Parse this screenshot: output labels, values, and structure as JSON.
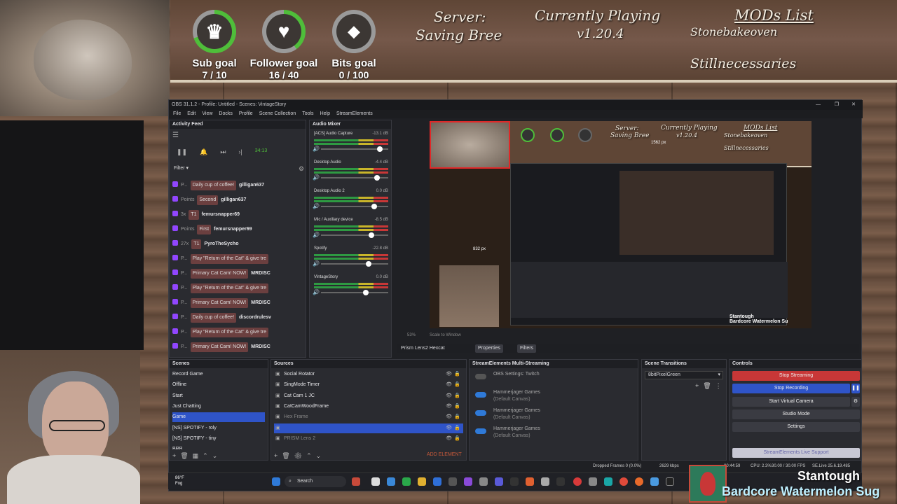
{
  "goals": [
    {
      "label": "Sub goal",
      "value": "7 / 10",
      "icon": "crown-icon",
      "progress": 0.7,
      "color": "#4fbe3a"
    },
    {
      "label": "Follower goal",
      "value": "16 / 40",
      "icon": "heart-icon",
      "progress": 0.4,
      "color": "#4fbe3a"
    },
    {
      "label": "Bits goal",
      "value": "0 / 100",
      "icon": "bits-icon",
      "progress": 0.0,
      "color": "#4fbe3a"
    }
  ],
  "banner": {
    "server_line1": "Server:",
    "server_line2": "Saving Bree",
    "playing_line1": "Currently Playing",
    "playing_line2": "v1.20.4",
    "mods_title": "MODs List",
    "mods_scroll1": "Stonebakeoven",
    "mods_scroll2": "Stillnecessaries"
  },
  "obs": {
    "title": "OBS 31.1.2 - Profile: Untitled - Scenes: VintageStory",
    "menu": [
      "File",
      "Edit",
      "View",
      "Docks",
      "Profile",
      "Scene Collection",
      "Tools",
      "Help",
      "StreamElements"
    ],
    "activity_feed": {
      "title": "Activity Feed",
      "filter_label": "Filter",
      "timer": "34:13",
      "rows": [
        {
          "tag": "P...",
          "pill": "Daily cup of coffee!",
          "user": "gilligan637"
        },
        {
          "tag": "Points",
          "pill": "Second",
          "user": "gilligan637"
        },
        {
          "tag": "3x",
          "pill": "T1",
          "user": "femursnapper69"
        },
        {
          "tag": "Points",
          "pill": "First",
          "user": "femursnapper69"
        },
        {
          "tag": "27x",
          "pill": "T1",
          "user": "PyroTheSycho"
        },
        {
          "tag": "P...",
          "pill": "Play \"Return of the Cat\" & give tre",
          "user": ""
        },
        {
          "tag": "P...",
          "pill": "Primary Cat Cam! NOW!",
          "user": "MRDISC"
        },
        {
          "tag": "P...",
          "pill": "Play \"Return of the Cat\" & give tre",
          "user": ""
        },
        {
          "tag": "P...",
          "pill": "Primary Cat Cam! NOW!",
          "user": "MRDISC"
        },
        {
          "tag": "P...",
          "pill": "Daily cup of coffee!",
          "user": "discordrulesv"
        },
        {
          "tag": "P...",
          "pill": "Play \"Return of the Cat\" & give tre",
          "user": ""
        },
        {
          "tag": "P...",
          "pill": "Primary Cat Cam! NOW!",
          "user": "MRDISC"
        }
      ]
    },
    "audio_mixer": {
      "title": "Audio Mixer",
      "channels": [
        {
          "name": "[ACS] Audio Capture",
          "db": "-13.1 dB"
        },
        {
          "name": "Desktop Audio",
          "db": "-4.4 dB"
        },
        {
          "name": "Desktop Audio 2",
          "db": "0.0 dB"
        },
        {
          "name": "Mic / Auxiliary device",
          "db": "-8.5 dB"
        },
        {
          "name": "Spotify",
          "db": "-22.8 dB"
        },
        {
          "name": "VintageStory",
          "db": "0.0 dB"
        }
      ]
    },
    "preview": {
      "server_line1": "Server:",
      "server_line2": "Saving Bree",
      "playing_line1": "Currently Playing",
      "playing_line2": "v1.20.4",
      "mods_title": "MODs List",
      "mods_scroll1": "Stonebakeoven",
      "mods_scroll2": "Stillnecessaries",
      "px_label_1": "1562 px",
      "px_label_2": "832 px",
      "scale_text": "Scale to Window",
      "zoom": "53%",
      "overlay_user": "Stantough",
      "overlay_name": "Bardcore  Watermelon Su"
    },
    "source_bar": {
      "selected": "Prism Lens2 Hexcat",
      "properties": "Properties",
      "filters": "Filters"
    },
    "scenes": {
      "title": "Scenes",
      "items": [
        "Record Game",
        "Offline",
        "Start",
        "Just Chatting",
        "Game",
        "[NS] SPOTIFY - roly",
        "[NS] SPOTIFY - tiny",
        "BRB"
      ],
      "selected_index": 4
    },
    "sources": {
      "title": "Sources",
      "items": [
        "Social Rotator",
        "SingMode Timer",
        "Cat Cam 1 JC",
        "CatCamWoodFrame",
        "Hex Frame",
        "",
        "PRISM Lens 2"
      ],
      "add_label": "ADD ELEMENT"
    },
    "multistream": {
      "title": "StreamElements Multi-Streaming",
      "rows": [
        {
          "name": "OBS Settings: Twitch",
          "detail": ""
        },
        {
          "name": "Hammerjager Games",
          "detail": "(Default Canvas)"
        },
        {
          "name": "Hammerjager Games",
          "detail": "(Default Canvas)"
        },
        {
          "name": "Hammerjager Games",
          "detail": "(Default Canvas)"
        }
      ]
    },
    "transitions": {
      "title": "Scene Transitions",
      "selected": "8bitPixelGreen"
    },
    "controls": {
      "title": "Controls",
      "stop_streaming": "Stop Streaming",
      "stop_recording": "Stop Recording",
      "virtual_camera": "Start Virtual Camera",
      "studio_mode": "Studio Mode",
      "settings": "Settings",
      "support": "StreamElements Live Support"
    },
    "status": {
      "dropped": "Dropped Frames 0 (0.0%)",
      "kbps": "2629 kbps",
      "time": "00:44:59",
      "cpu": "CPU: 2.3%",
      "fps": "30.00 / 30.00 FPS",
      "version": "SE.Live 25.6.19.485"
    }
  },
  "taskbar": {
    "weather_temp": "86°F",
    "weather_desc": "Fog",
    "search": "Search"
  },
  "stream_overlay": {
    "username": "Stantough",
    "names": "Bardcore   Watermelon Sug"
  }
}
